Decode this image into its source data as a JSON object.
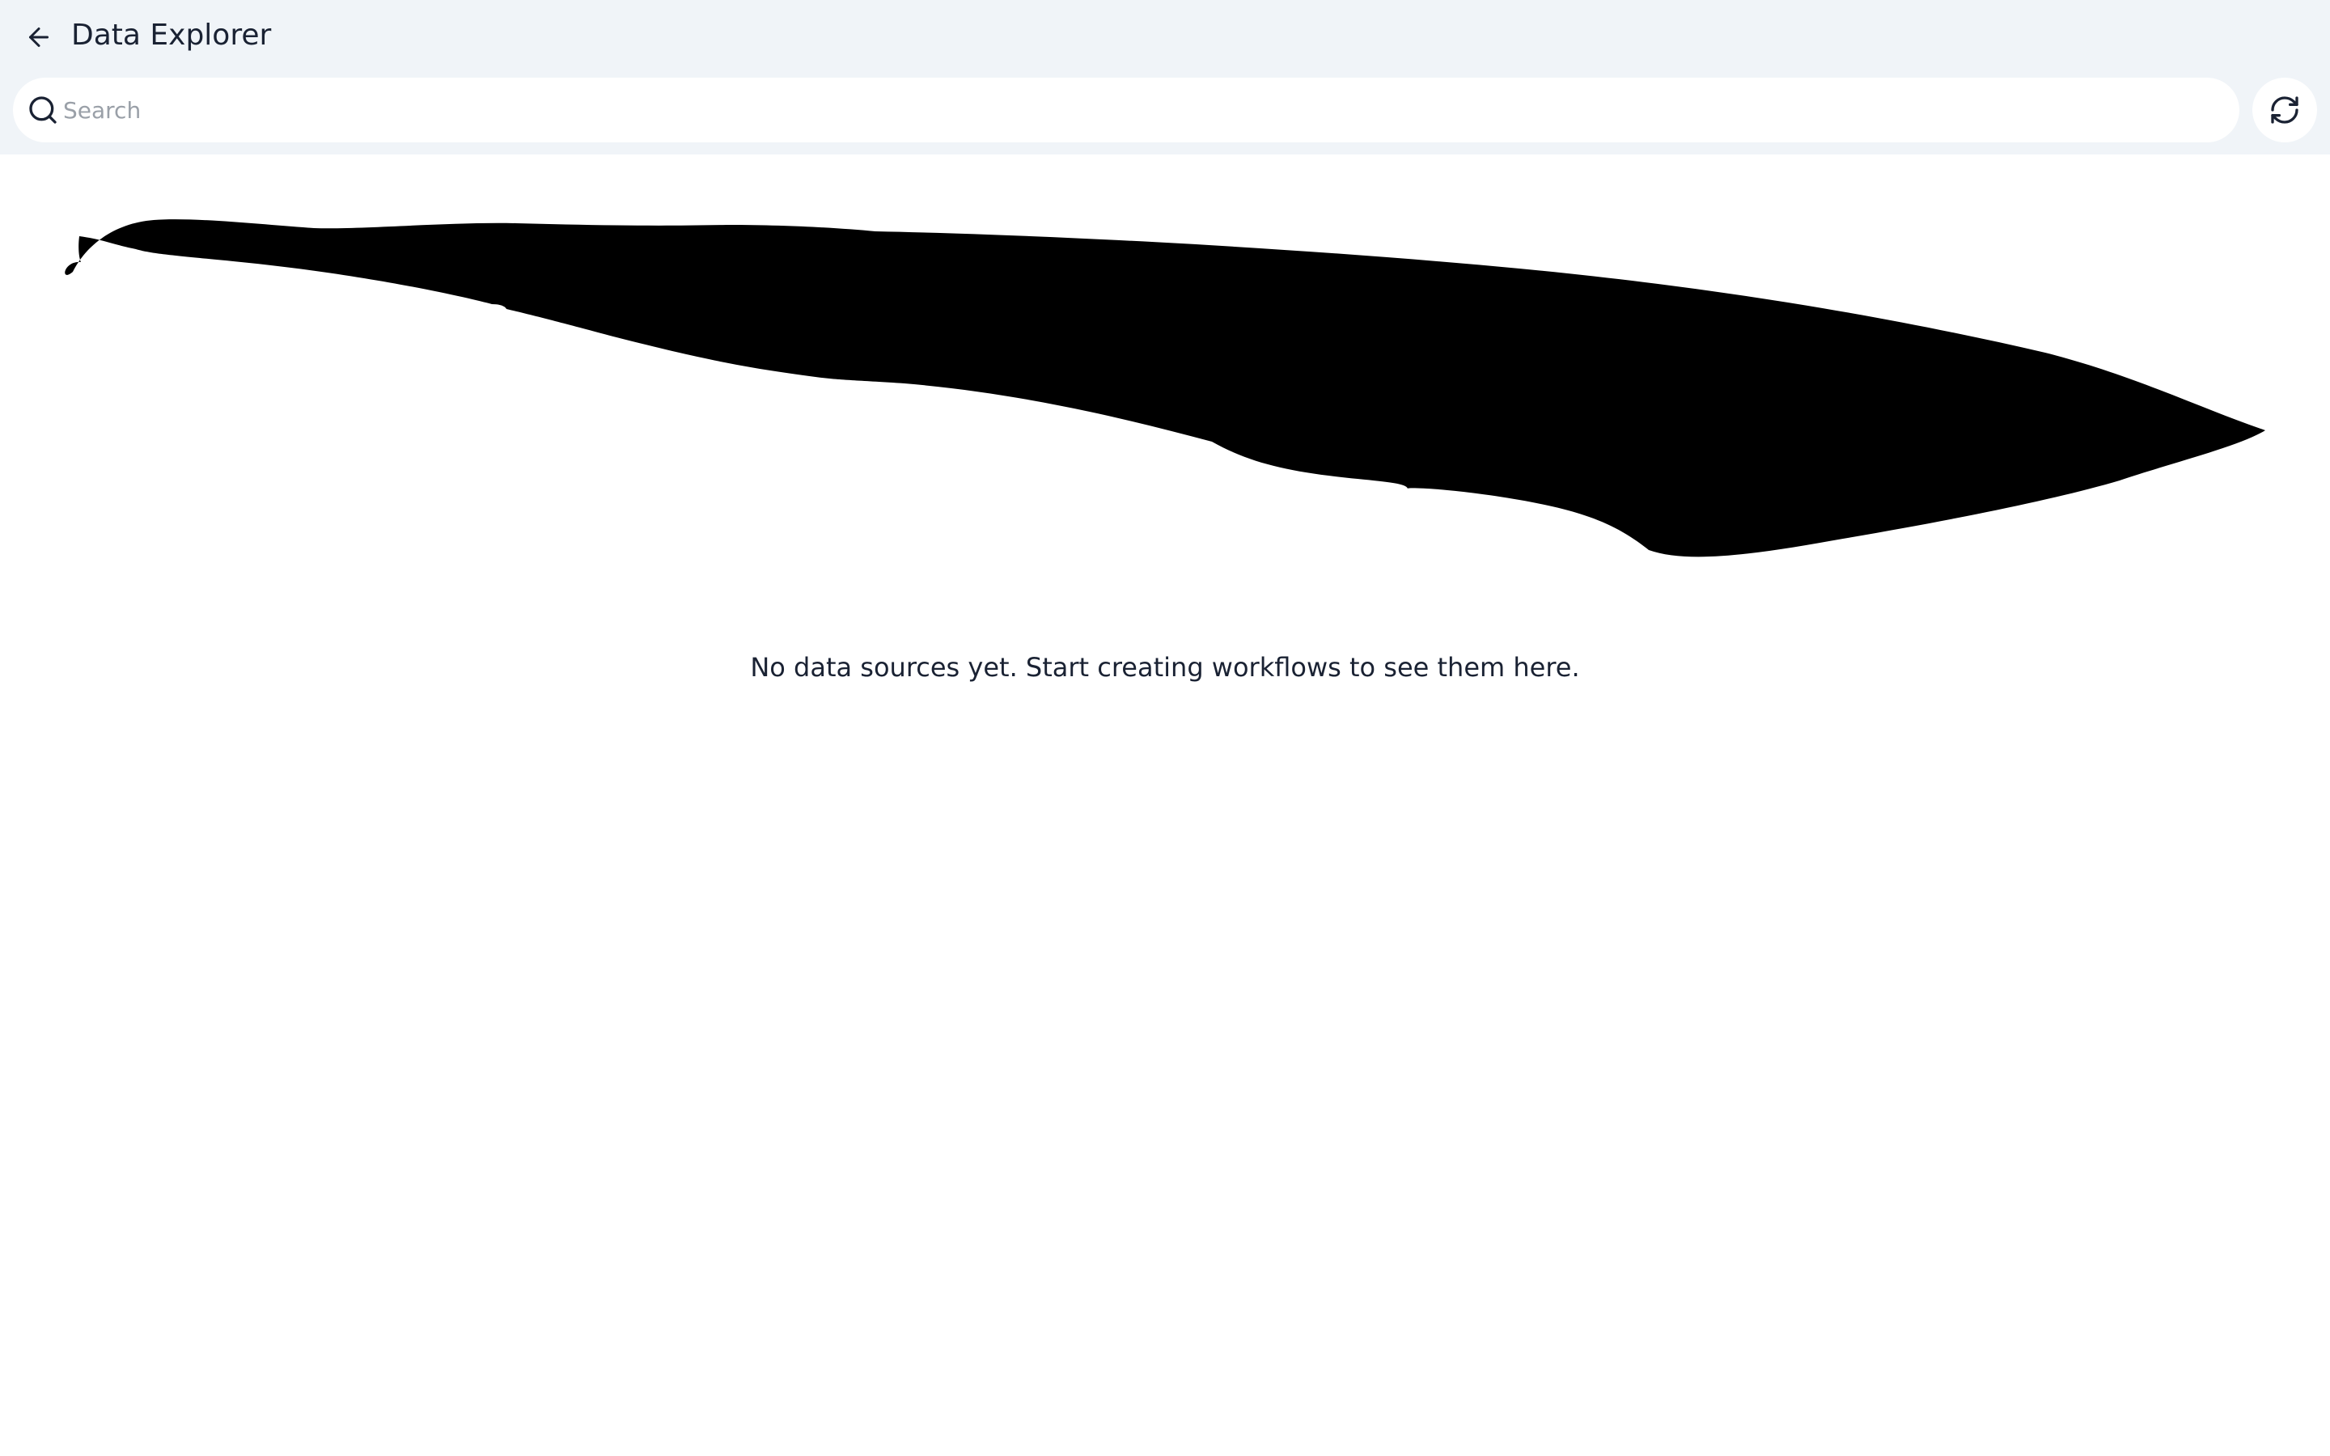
{
  "header": {
    "title": "Data Explorer",
    "back_icon": "arrow-left-icon"
  },
  "search": {
    "placeholder": "Search",
    "value": "",
    "icon": "search-icon"
  },
  "toolbar": {
    "refresh_icon": "refresh-icon"
  },
  "empty_state": {
    "illustration": "empty-state-illustration",
    "message": "No data sources yet. Start creating workflows to see them here."
  },
  "colors": {
    "header_bg": "#f0f4f8",
    "text": "#1a2233",
    "placeholder": "#9aa0a8",
    "background": "#ffffff"
  }
}
